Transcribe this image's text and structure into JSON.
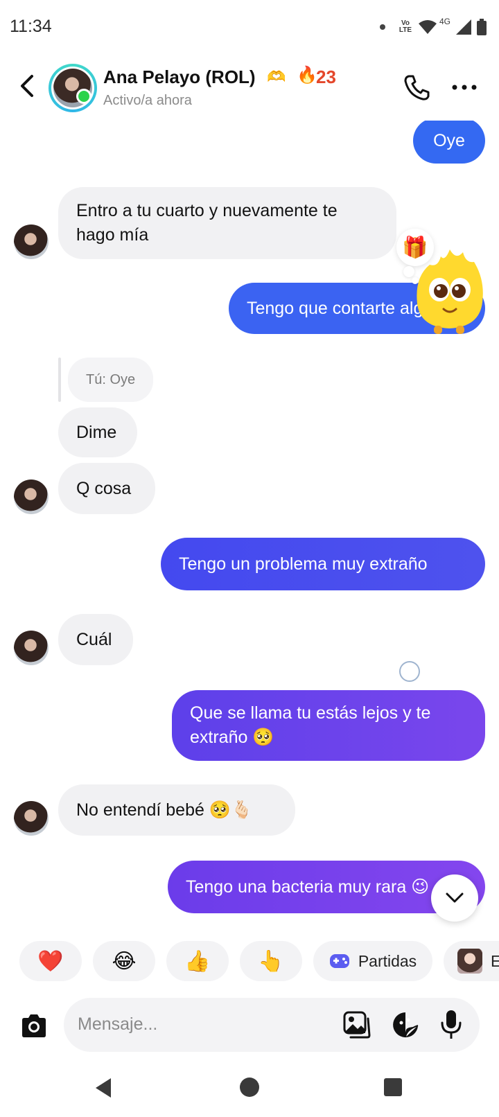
{
  "status_bar": {
    "time": "11:34",
    "volte": "Vo\nLTE",
    "network": "4G"
  },
  "header": {
    "name": "Ana Pelayo (ROL)",
    "streak_count": "23",
    "status": "Activo/a ahora",
    "online": true,
    "icons": [
      "back-arrow-icon",
      "heart-hands-icon",
      "fire-icon",
      "phone-icon",
      "more-icon"
    ]
  },
  "messages": [
    {
      "from": "me",
      "text": "Oye"
    },
    {
      "from": "them",
      "text": "Entro a tu cuarto y nuevamente te hago mía"
    },
    {
      "from": "me",
      "text": "Tengo que contarte algo"
    },
    {
      "from": "reply-quote",
      "text": "Tú: Oye"
    },
    {
      "from": "them",
      "text": "Dime"
    },
    {
      "from": "them",
      "text": "Q cosa"
    },
    {
      "from": "me",
      "text": "Tengo un problema muy extraño"
    },
    {
      "from": "them",
      "text": "Cuál"
    },
    {
      "from": "me",
      "text": "Que se llama tu estás lejos y te extraño 🥺"
    },
    {
      "from": "them",
      "text": "No entendí bebé 🥺🫰🏻"
    },
    {
      "from": "me",
      "text": "Tengo una bacteria muy rara 😉"
    }
  ],
  "gift_emoji": "🎁",
  "quick_reactions": [
    {
      "emoji": "❤️"
    },
    {
      "emoji": "😂"
    },
    {
      "emoji": "👍"
    },
    {
      "emoji": "👆"
    },
    {
      "label": "Partidas",
      "icon": "gamepad-icon"
    },
    {
      "label": "Ef",
      "icon": "effects-avatar"
    }
  ],
  "composer": {
    "placeholder": "Mensaje..."
  },
  "colors": {
    "bubble_blue": "#3b6cf4",
    "bubble_indigo": "#4750ea",
    "bubble_purple": "#7a46ea",
    "incoming": "#f1f1f3",
    "streak": "#e4472b",
    "online": "#2cd34b"
  }
}
